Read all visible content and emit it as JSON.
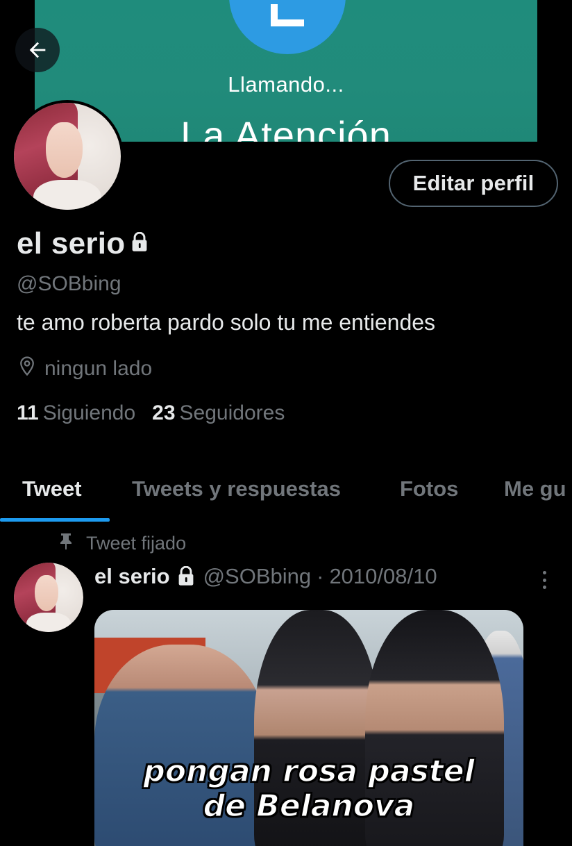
{
  "header": {
    "back_icon": "arrow-left-icon"
  },
  "banner": {
    "calling_text": "Llamando...",
    "callee_text": "La Atención",
    "background_color": "#218b7b",
    "avatar_color": "#2d9be3"
  },
  "profile": {
    "display_name": "el serio",
    "lock_icon": "lock-icon",
    "username": "@SOBbing",
    "bio": "te amo roberta pardo solo tu me entiendes",
    "location_icon": "location-pin-icon",
    "location": "ningun lado",
    "following_count": "11",
    "following_label": "Siguiendo",
    "followers_count": "23",
    "followers_label": "Seguidores",
    "edit_button_label": "Editar perfil"
  },
  "tabs": [
    {
      "label": "Tweet",
      "active": true
    },
    {
      "label": "Tweets y respuestas",
      "active": false
    },
    {
      "label": "Fotos",
      "active": false
    },
    {
      "label": "Me gu",
      "active": false
    }
  ],
  "pinned_tweet": {
    "pinned_icon": "pin-icon",
    "pinned_label": "Tweet fijado",
    "author_name": "el serio",
    "author_handle": "@SOBbing",
    "separator": "·",
    "date": "2010/08/10",
    "more_icon": "more-vertical-icon",
    "media_caption_line1": "pongan rosa pastel",
    "media_caption_line2": "de Belanova"
  },
  "colors": {
    "background": "#000000",
    "primary_text": "#e7e9ea",
    "secondary_text": "#71767b",
    "accent": "#1d9bf0",
    "border": "#536471"
  }
}
